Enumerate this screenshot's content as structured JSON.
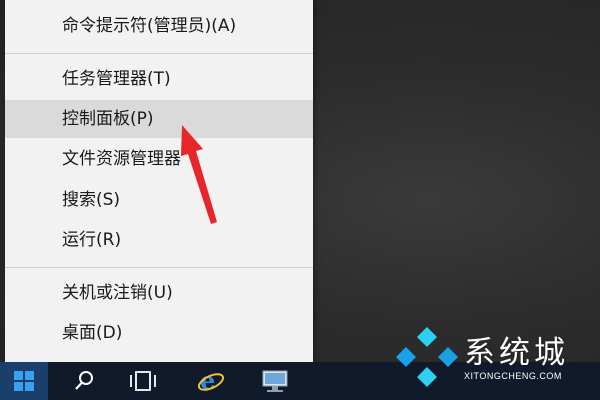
{
  "menu": {
    "items": [
      {
        "label": "命令提示符(管理员)(A)"
      },
      {
        "label": "任务管理器(T)"
      },
      {
        "label": "控制面板(P)"
      },
      {
        "label": "文件资源管理器"
      },
      {
        "label": "搜索(S)"
      },
      {
        "label": "运行(R)"
      },
      {
        "label": "关机或注销(U)"
      },
      {
        "label": "桌面(D)"
      }
    ],
    "highlighted_item": "控制面板(P)"
  },
  "annotation": {
    "arrow_color": "#e8262a"
  },
  "taskbar": {
    "buttons": [
      {
        "icon": "windows-start-icon"
      },
      {
        "icon": "search-icon"
      },
      {
        "icon": "task-view-icon"
      },
      {
        "icon": "internet-explorer-icon"
      },
      {
        "icon": "server-manager-icon"
      }
    ],
    "background_color": "#101a2a"
  },
  "watermark": {
    "title": "系统城",
    "url": "XITONGCHENG.COM",
    "logo_colors": [
      "#1aa0e8",
      "#2ed0f0"
    ]
  }
}
